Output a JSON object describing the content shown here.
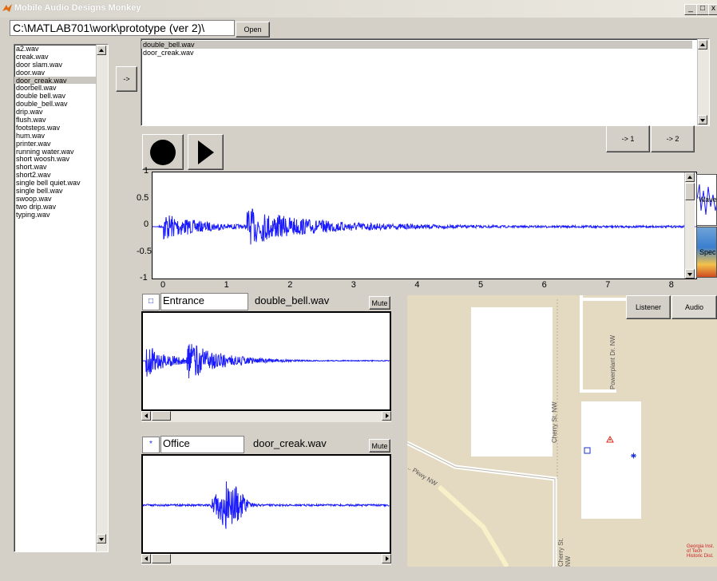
{
  "window": {
    "title": "Mobile Audio Designs Monkey",
    "min": "_",
    "max": "□",
    "close": "x"
  },
  "path": {
    "value": "C:\\MATLAB701\\work\\prototype (ver 2)\\",
    "open_label": "Open"
  },
  "file_list": [
    {
      "label": "a2.wav"
    },
    {
      "label": "creak.wav"
    },
    {
      "label": "door slam.wav"
    },
    {
      "label": "door.wav"
    },
    {
      "label": "door_creak.wav"
    },
    {
      "label": "doorbell.wav"
    },
    {
      "label": "double bell.wav"
    },
    {
      "label": "double_bell.wav"
    },
    {
      "label": "drip.wav"
    },
    {
      "label": "flush.wav"
    },
    {
      "label": "footsteps.wav"
    },
    {
      "label": "hum.wav"
    },
    {
      "label": "printer.wav"
    },
    {
      "label": "running water.wav"
    },
    {
      "label": "short woosh.wav"
    },
    {
      "label": "short.wav"
    },
    {
      "label": "short2.wav"
    },
    {
      "label": "single bell quiet.wav"
    },
    {
      "label": "single bell.wav"
    },
    {
      "label": "swoop.wav"
    },
    {
      "label": "two drip.wav"
    },
    {
      "label": "typing.wav"
    }
  ],
  "file_list_selected": "door_creak.wav",
  "add_button": "->",
  "selected_list": [
    {
      "label": "double_bell.wav"
    },
    {
      "label": "door_creak.wav"
    }
  ],
  "assign": {
    "one": "-> 1",
    "two": "-> 2"
  },
  "icons": {
    "record": "record-icon",
    "play": "play-icon",
    "waveform_thumb": "waveform-icon"
  },
  "main_plot": {
    "y_ticks": [
      "1",
      "0.5",
      "0",
      "-0.5",
      "-1"
    ],
    "x_ticks": [
      "0",
      "1",
      "2",
      "3",
      "4",
      "5",
      "6",
      "7",
      "8"
    ],
    "waveform_color": "#1a1aff"
  },
  "side_tabs": {
    "wave": "Wave",
    "spec": "Spec"
  },
  "channel1": {
    "marker": "□",
    "name": "Entrance",
    "file": "double_bell.wav",
    "mute": "Mute"
  },
  "channel2": {
    "marker": "*",
    "name": "Office",
    "file": "door_creak.wav",
    "mute": "Mute"
  },
  "map": {
    "tabs": {
      "listener": "Listener",
      "audio": "Audio"
    },
    "streets": {
      "cherry1": "Cherry St. NW",
      "cherry2": "Cherry St. NW",
      "powerplant": "Powerplant Dr. NW",
      "pkwy": "... Pkwy NW"
    },
    "seal": "Georgia Inst. of Tech Historic Dist."
  }
}
